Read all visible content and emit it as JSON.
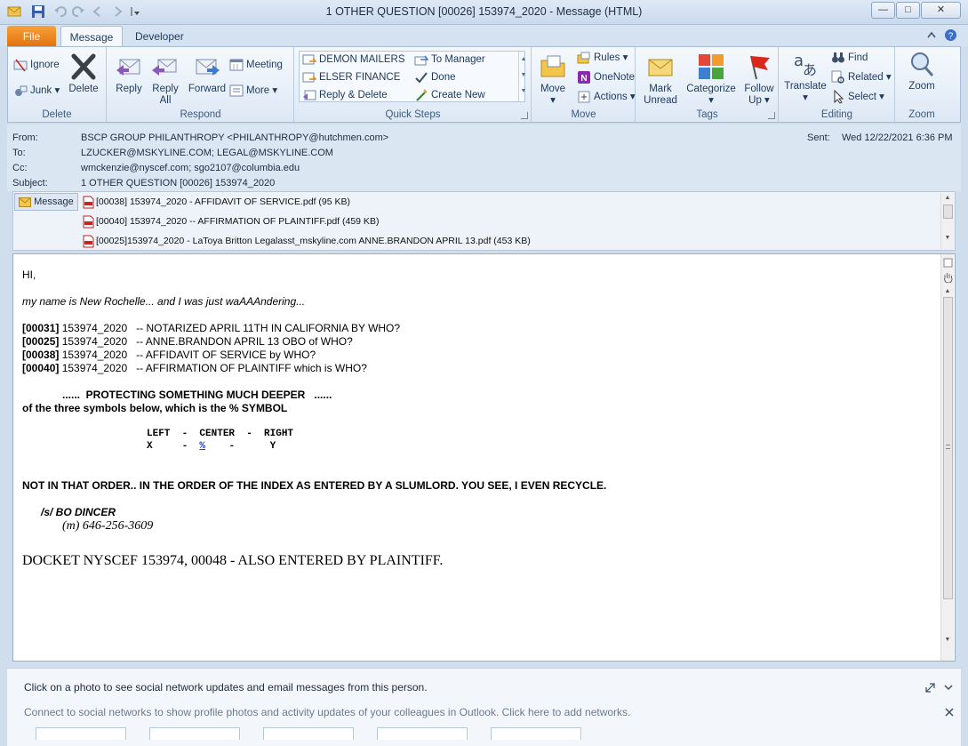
{
  "window": {
    "title": "1 OTHER QUESTION  [00026] 153974_2020  -  Message (HTML)"
  },
  "tabs": {
    "file": "File",
    "message": "Message",
    "developer": "Developer"
  },
  "ribbon": {
    "delete_group": {
      "label": "Delete",
      "ignore": "Ignore",
      "junk": "Junk",
      "delete": "Delete"
    },
    "respond_group": {
      "label": "Respond",
      "reply": "Reply",
      "reply_all_1": "Reply",
      "reply_all_2": "All",
      "forward": "Forward",
      "meeting": "Meeting",
      "more": "More"
    },
    "quick_steps": {
      "label": "Quick Steps",
      "items": [
        "DEMON MAILERS",
        "ELSER FINANCE",
        "Reply & Delete",
        "To Manager",
        "Done",
        "Create New"
      ]
    },
    "move_group": {
      "label": "Move",
      "move": "Move",
      "rules": "Rules",
      "onenote": "OneNote",
      "actions": "Actions"
    },
    "tags_group": {
      "label": "Tags",
      "mark_unread_1": "Mark",
      "mark_unread_2": "Unread",
      "categorize": "Categorize",
      "follow_up_1": "Follow",
      "follow_up_2": "Up"
    },
    "editing_group": {
      "label": "Editing",
      "translate": "Translate",
      "find": "Find",
      "related": "Related",
      "select": "Select"
    },
    "zoom_group": {
      "label": "Zoom",
      "zoom": "Zoom"
    }
  },
  "header": {
    "from_label": "From:",
    "from": "BSCP GROUP PHILANTHROPY <PHILANTHROPY@hutchmen.com>",
    "to_label": "To:",
    "to": "LZUCKER@MSKYLINE.COM; LEGAL@MSKYLINE.COM",
    "cc_label": "Cc:",
    "cc": "wmckenzie@nyscef.com; sgo2107@columbia.edu",
    "subject_label": "Subject:",
    "subject": "1 OTHER QUESTION  [00026] 153974_2020",
    "sent_label": "Sent:",
    "sent": "Wed 12/22/2021 6:36 PM"
  },
  "attachments": {
    "message_tab": "Message",
    "files": [
      "[00038] 153974_2020 - AFFIDAVIT OF SERVICE.pdf (95 KB)",
      "[00040] 153974_2020 -- AFFIRMATION OF PLAINTIFF.pdf (459 KB)",
      "[00025]153974_2020 - LaToya Britton Legalasst_mskyline.com ANNE.BRANDON APRIL 13.pdf (453 KB)"
    ]
  },
  "body": {
    "greeting": "HI,",
    "intro": "my name is New Rochelle... and I was just waAAAndering...",
    "items": [
      {
        "id": "[00031]",
        "text": " 153974_2020   -- NOTARIZED APRIL 11TH IN CALIFORNIA BY WHO?"
      },
      {
        "id": "[00025]",
        "text": " 153974_2020   -- ANNE.BRANDON APRIL 13 OBO of WHO?"
      },
      {
        "id": "[00038]",
        "text": " 153974_2020   -- AFFIDAVIT OF SERVICE by WHO?"
      },
      {
        "id": "[00040]",
        "text": " 153974_2020   -- AFFIRMATION OF PLAINTIFF which is WHO?"
      }
    ],
    "protecting": "......  PROTECTING SOMETHING MUCH DEEPER   ......",
    "symbols_q": "of the three symbols below, which is the % SYMBOL",
    "lcr_header": "LEFT  -  CENTER  -  RIGHT",
    "lcr_x": "X     -",
    "lcr_pct": "%",
    "lcr_y": "-      Y",
    "order": "NOT IN THAT ORDER.. IN THE ORDER OF THE INDEX AS ENTERED BY A SLUMLORD. YOU SEE, I EVEN RECYCLE.",
    "signature": "/s/ BO DINCER",
    "phone": "(m) 646-256-3609",
    "docket": "DOCKET NYSCEF 153974, 00048 - ALSO ENTERED BY PLAINTIFF."
  },
  "people_pane": {
    "line1": "Click on a photo to see social network updates and email messages from this person.",
    "line2": "Connect to social networks to show profile photos and activity updates of your colleagues in Outlook. Click here to add networks."
  }
}
